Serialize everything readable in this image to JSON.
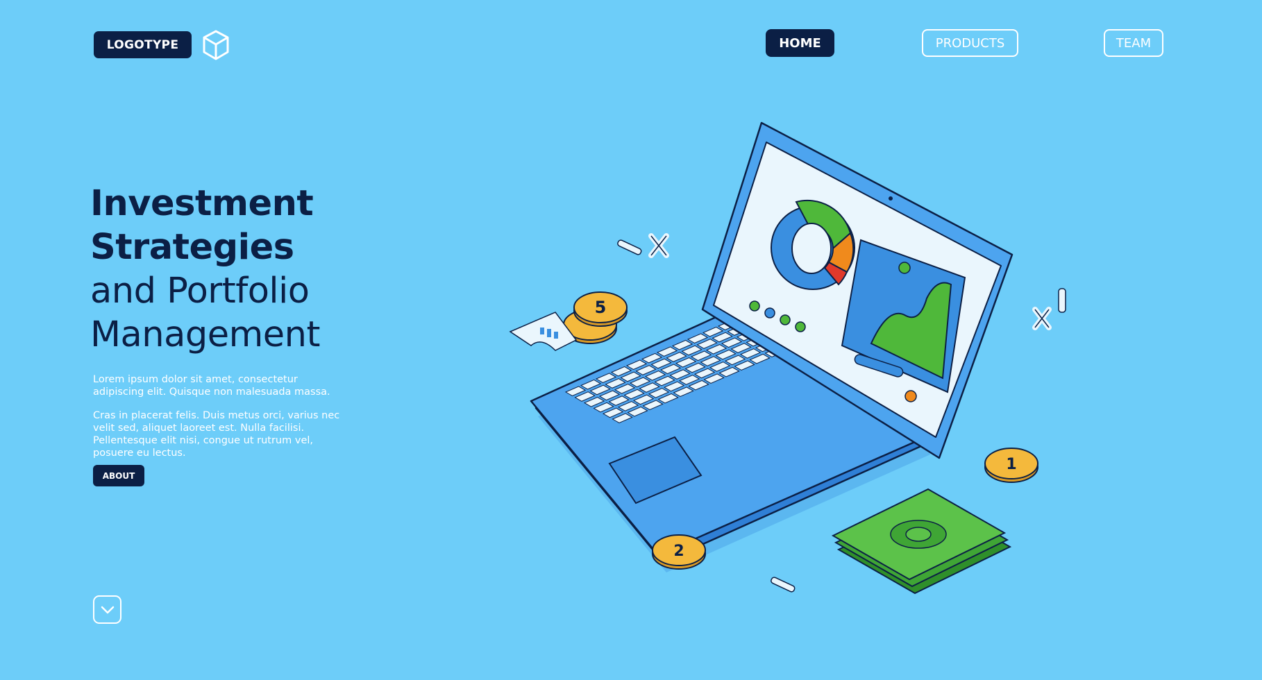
{
  "nav": {
    "logo_label": "LOGOTYPE",
    "logo_icon": "cube-icon",
    "links": [
      {
        "label": "HOME",
        "active": true
      },
      {
        "label": "PRODUCTS",
        "active": false
      },
      {
        "label": "TEAM",
        "active": false
      }
    ]
  },
  "hero": {
    "title_line1": "Investment",
    "title_line2": "Strategies",
    "subtitle_line1": "and Portfolio",
    "subtitle_line2": "Management",
    "paragraph1": "Lorem ipsum dolor sit amet, consectetur adipiscing elit. Quisque non malesuada massa.",
    "paragraph2": "Cras in placerat felis. Duis metus orci, varius nec velit sed, aliquet laoreet est. Nulla facilisi. Pellentesque elit nisi, congue ut rutrum vel, posuere eu lectus.",
    "about_label": "ABOUT",
    "scroll_icon": "chevron-down-icon"
  },
  "illustration": {
    "coin_labels": [
      "5",
      "1",
      "2"
    ],
    "colors": {
      "background": "#6dcdf9",
      "dark": "#0b1f45",
      "laptop_blue": "#3a8fe0",
      "screen": "#eaf6fd",
      "green": "#4fb83a",
      "orange": "#f08a1c",
      "red": "#e0392b",
      "gold": "#f4b93c"
    }
  }
}
